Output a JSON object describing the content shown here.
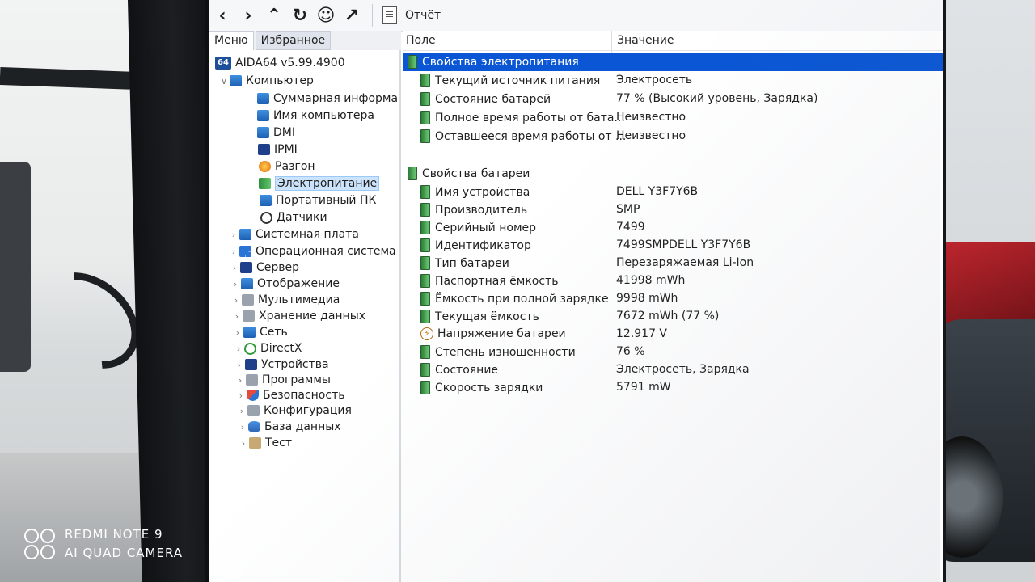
{
  "toolbar": {
    "report_label": "Отчёт"
  },
  "menu_tabs": [
    {
      "label": "Меню"
    },
    {
      "label": "Избранное"
    }
  ],
  "tree": {
    "root": "AIDA64 v5.99.4900",
    "root_icon_text": "64",
    "computer": "Компьютер",
    "computer_children": [
      "Суммарная информа",
      "Имя компьютера",
      "DMI",
      "IPMI",
      "Разгон",
      "Электропитание",
      "Портативный ПК",
      "Датчики"
    ],
    "top_level": [
      "Системная плата",
      "Операционная система",
      "Сервер",
      "Отображение",
      "Мультимедиа",
      "Хранение данных",
      "Сеть",
      "DirectX",
      "Устройства",
      "Программы",
      "Безопасность",
      "Конфигурация",
      "База данных",
      "Тест"
    ]
  },
  "columns": {
    "field": "Поле",
    "value": "Значение"
  },
  "power_group": {
    "title": "Свойства электропитания",
    "rows": [
      {
        "field": "Текущий источник питания",
        "value": "Электросеть"
      },
      {
        "field": "Состояние батарей",
        "value": "77 % (Высокий уровень, Зарядка)"
      },
      {
        "field": "Полное время работы от бата...",
        "value": "Неизвестно"
      },
      {
        "field": "Оставшееся время работы от ...",
        "value": "Неизвестно"
      }
    ]
  },
  "battery_group": {
    "title": "Свойства батареи",
    "rows": [
      {
        "field": "Имя устройства",
        "value": "DELL Y3F7Y6B"
      },
      {
        "field": "Производитель",
        "value": "SMP"
      },
      {
        "field": "Серийный номер",
        "value": "7499"
      },
      {
        "field": "Идентификатор",
        "value": "7499SMPDELL Y3F7Y6B"
      },
      {
        "field": "Тип батареи",
        "value": "Перезаряжаемая Li-Ion"
      },
      {
        "field": "Паспортная ёмкость",
        "value": "41998 mWh"
      },
      {
        "field": "Ёмкость при полной зарядке",
        "value": "9998 mWh"
      },
      {
        "field": "Текущая ёмкость",
        "value": "7672 mWh  (77 %)"
      },
      {
        "field": "Напряжение батареи",
        "value": "12.917 V"
      },
      {
        "field": "Степень изношенности",
        "value": "76 %"
      },
      {
        "field": "Состояние",
        "value": "Электросеть, Зарядка"
      },
      {
        "field": "Скорость зарядки",
        "value": "5791 mW"
      }
    ]
  },
  "watermark": {
    "line1": "REDMI NOTE 9",
    "line2": "AI QUAD CAMERA"
  },
  "colors": {
    "selection": "#0a56d4",
    "tree_selection": "#cce4fb"
  }
}
